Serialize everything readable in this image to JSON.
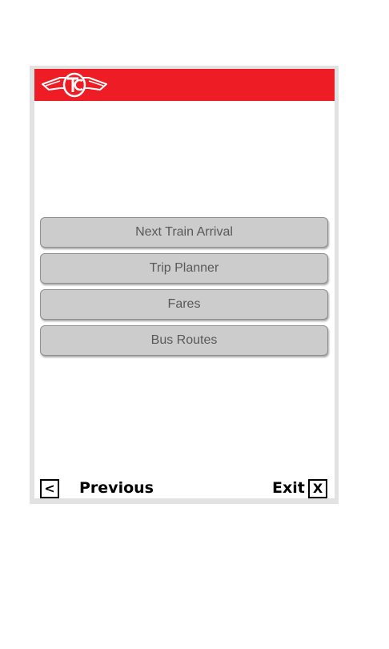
{
  "header": {
    "logo_icon": "ttc-logo-icon",
    "background_color": "#ee1c25"
  },
  "menu": {
    "items": [
      {
        "label": "Next Train Arrival"
      },
      {
        "label": "Trip Planner"
      },
      {
        "label": "Fares"
      },
      {
        "label": "Bus Routes"
      }
    ]
  },
  "footer": {
    "previous_symbol": "<",
    "previous_label": "Previous",
    "exit_label": "Exit",
    "exit_symbol": "X"
  }
}
